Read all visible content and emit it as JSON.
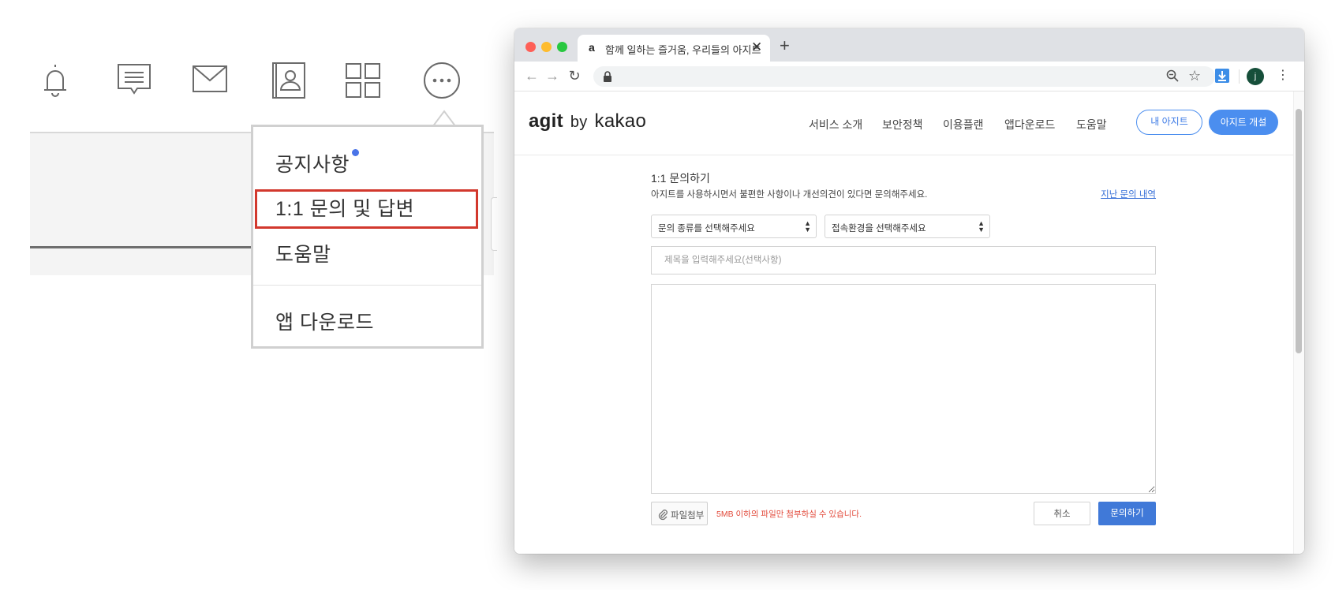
{
  "left_panel": {
    "icons": [
      "bell-icon",
      "chat-bubble-icon",
      "mail-icon",
      "contact-card-icon",
      "grid-icon",
      "more-icon"
    ],
    "menu": {
      "notice": "공지사항",
      "inquiry": "1:1 문의 및 답변",
      "help": "도움말",
      "app_download": "앱 다운로드"
    },
    "highlight_color": "#d2382d",
    "notice_dot_color": "#4a74e8"
  },
  "browser": {
    "tab": {
      "favicon": "a",
      "title": "함께 일하는 즐거움, 우리들의 아지트",
      "close": "✕"
    },
    "new_tab": "+",
    "nav": {
      "back": "←",
      "forward": "→",
      "reload": "↻"
    },
    "toolbar": {
      "star": "☆",
      "profile_initial": "j",
      "menu": "⋮"
    }
  },
  "site": {
    "logo": {
      "agit": "agit",
      "by": "by",
      "kakao": "kakao"
    },
    "nav": [
      "서비스 소개",
      "보안정책",
      "이용플랜",
      "앱다운로드",
      "도움말"
    ],
    "my_agit_button": "내 아지트",
    "open_agit_button": "아지트 개설",
    "accent_color": "#4b8eef"
  },
  "form": {
    "title": "1:1 문의하기",
    "description": "아지트를 사용하시면서 불편한 사항이나 개선의견이 있다면 문의해주세요.",
    "history_link": "지난 문의 내역",
    "type_select": "문의 종류를 선택해주세요",
    "env_select": "접속환경을 선택해주세요",
    "subject_placeholder": "제목을 입력해주세요(선택사항)",
    "body_value": "",
    "attach_label": "파일첨부",
    "attach_notice": "5MB 이하의 파일만 첨부하실 수 있습니다.",
    "cancel_label": "취소",
    "submit_label": "문의하기"
  }
}
